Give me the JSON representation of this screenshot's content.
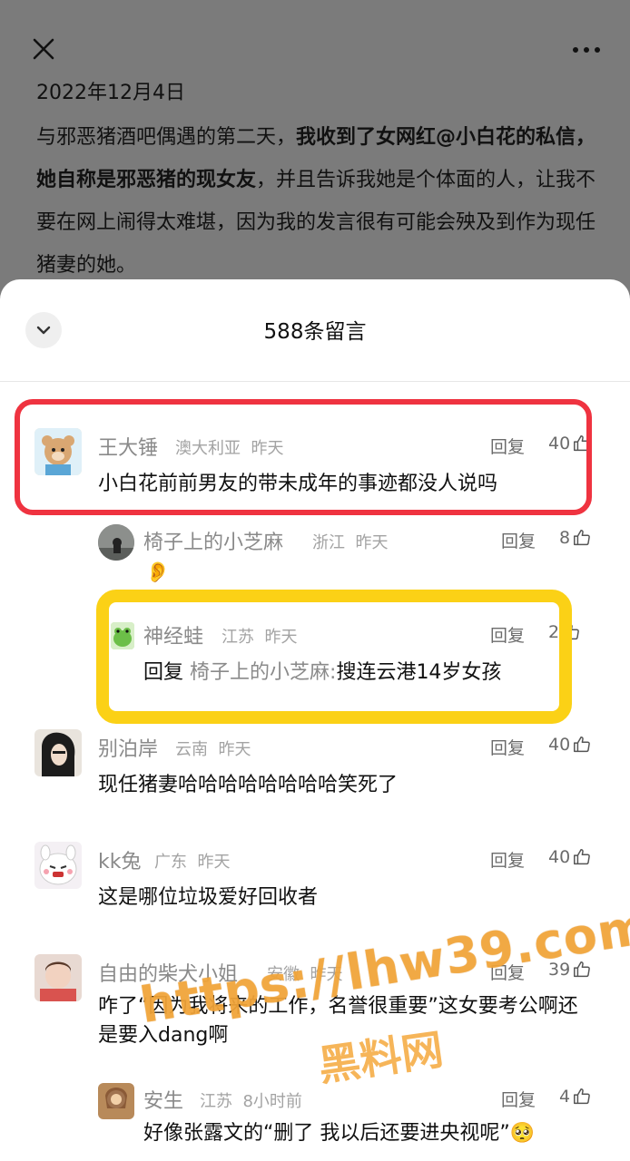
{
  "article": {
    "date": "2022年12月4日",
    "para_plain_1": "与邪恶猪酒吧偶遇的第二天，",
    "para_bold_1": "我收到了女网红@小白花的私信，她自称是邪恶猪的现女友",
    "para_plain_2": "，并且告诉我她是个体面的人，让我不要在网上闹得太难堪，因为我的发言很有可能会殃及到作为现任猪妻的她。"
  },
  "sheet": {
    "title": "588条留言"
  },
  "comments": [
    {
      "name": "王大锤",
      "region": "澳大利亚",
      "time": "昨天",
      "reply_label": "回复",
      "likes": "40",
      "text": "小白花前前男友的带未成年的事迹都没人说吗"
    },
    {
      "name": "椅子上的小芝麻",
      "region": "浙江",
      "time": "昨天",
      "reply_label": "回复",
      "likes": "8",
      "text": "👂"
    },
    {
      "name": "神经蛙",
      "region": "江苏",
      "time": "昨天",
      "reply_label": "回复",
      "likes": "2",
      "reply_prefix": "回复",
      "reply_to": "椅子上的小芝麻:",
      "text": "搜连云港14岁女孩"
    },
    {
      "name": "别泊岸",
      "region": "云南",
      "time": "昨天",
      "reply_label": "回复",
      "likes": "40",
      "text": "现任猪妻哈哈哈哈哈哈哈哈笑死了"
    },
    {
      "name": "kk兔",
      "region": "广东",
      "time": "昨天",
      "reply_label": "回复",
      "likes": "40",
      "text": "这是哪位垃圾爱好回收者"
    },
    {
      "name": "自由的柴犬小姐",
      "region": "安徽",
      "time": "昨天",
      "reply_label": "回复",
      "likes": "39",
      "text": "咋了“因为我将来的工作，名誉很重要”这女要考公啊还是要入dang啊"
    },
    {
      "name": "安生",
      "region": "江苏",
      "time": "8小时前",
      "reply_label": "回复",
      "likes": "4",
      "text": "好像张露文的“删了 我以后还要进央视呢”🥺"
    }
  ],
  "watermark": {
    "url": "https://lhw39.com",
    "cn": "黑料网"
  },
  "colors": {
    "red_box": "#ef3340",
    "yellow_box": "#fbd116",
    "watermark": "#f5a83c"
  }
}
